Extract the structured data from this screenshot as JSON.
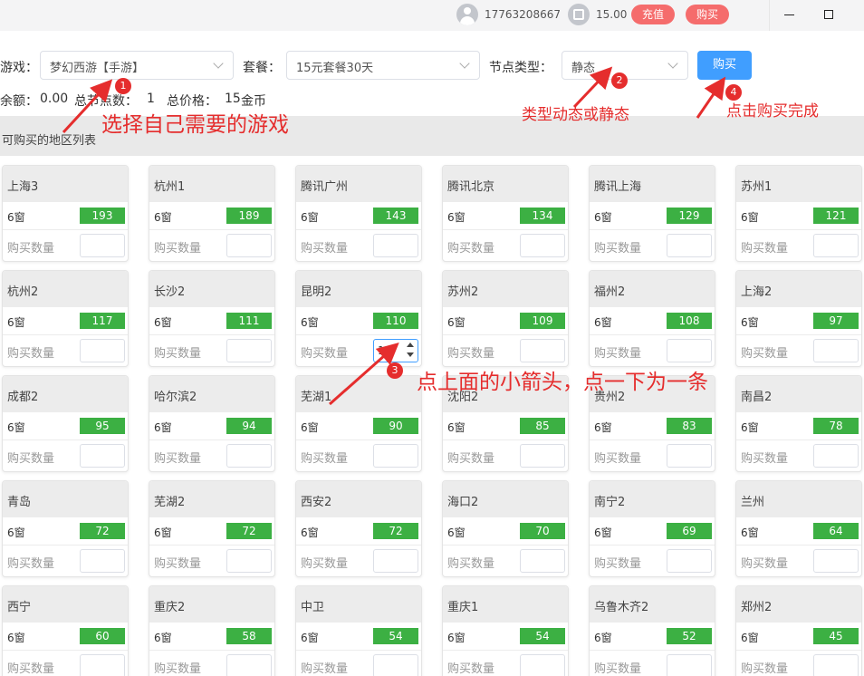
{
  "titlebar": {
    "phone": "17763208667",
    "balance": "15.00",
    "recharge_label": "充值",
    "buy_label": "购买"
  },
  "filters": {
    "game_label": "游戏：",
    "game_value": "梦幻西游【手游】",
    "package_label": "套餐：",
    "package_value": "15元套餐30天",
    "node_type_label": "节点类型：",
    "node_type_value": "静态",
    "buy_button": "购买"
  },
  "summary": {
    "balance_label": "余额：",
    "balance_value": "0.00",
    "node_count_label": "总节点数：",
    "node_count_value": "1",
    "total_price_label": "总价格：",
    "total_price_value": "15",
    "currency": "金币"
  },
  "section_title": "可购买的地区列表",
  "card_labels": {
    "windows": "6窗",
    "quantity": "购买数量"
  },
  "regions": [
    {
      "name": "上海3",
      "count": "193"
    },
    {
      "name": "杭州1",
      "count": "189"
    },
    {
      "name": "腾讯广州",
      "count": "143"
    },
    {
      "name": "腾讯北京",
      "count": "134"
    },
    {
      "name": "腾讯上海",
      "count": "129"
    },
    {
      "name": "苏州1",
      "count": "121"
    },
    {
      "name": "杭州2",
      "count": "117"
    },
    {
      "name": "长沙2",
      "count": "111"
    },
    {
      "name": "昆明2",
      "count": "110",
      "qty": "1"
    },
    {
      "name": "苏州2",
      "count": "109"
    },
    {
      "name": "福州2",
      "count": "108"
    },
    {
      "name": "上海2",
      "count": "97"
    },
    {
      "name": "成都2",
      "count": "95"
    },
    {
      "name": "哈尔滨2",
      "count": "94"
    },
    {
      "name": "芜湖1",
      "count": "90"
    },
    {
      "name": "沈阳2",
      "count": "85"
    },
    {
      "name": "贵州2",
      "count": "83"
    },
    {
      "name": "南昌2",
      "count": "78"
    },
    {
      "name": "青岛",
      "count": "72"
    },
    {
      "name": "芜湖2",
      "count": "72"
    },
    {
      "name": "西安2",
      "count": "72"
    },
    {
      "name": "海口2",
      "count": "70"
    },
    {
      "name": "南宁2",
      "count": "69"
    },
    {
      "name": "兰州",
      "count": "64"
    },
    {
      "name": "西宁",
      "count": "60"
    },
    {
      "name": "重庆2",
      "count": "58"
    },
    {
      "name": "中卫",
      "count": "54"
    },
    {
      "name": "重庆1",
      "count": "54"
    },
    {
      "name": "乌鲁木齐2",
      "count": "52"
    },
    {
      "name": "郑州2",
      "count": "45"
    }
  ],
  "annotations": {
    "note1": "选择自己需要的游戏",
    "note2": "类型动态或静态",
    "note3": "点上面的小箭头，点一下为一条",
    "note4": "点击购买完成",
    "badge1": "1",
    "badge2": "2",
    "badge3": "3",
    "badge4": "4",
    "color": "#e52d2d"
  },
  "colors": {
    "accent": "#409eff",
    "count_badge": "#3cb043",
    "pill": "#f56c6c"
  }
}
